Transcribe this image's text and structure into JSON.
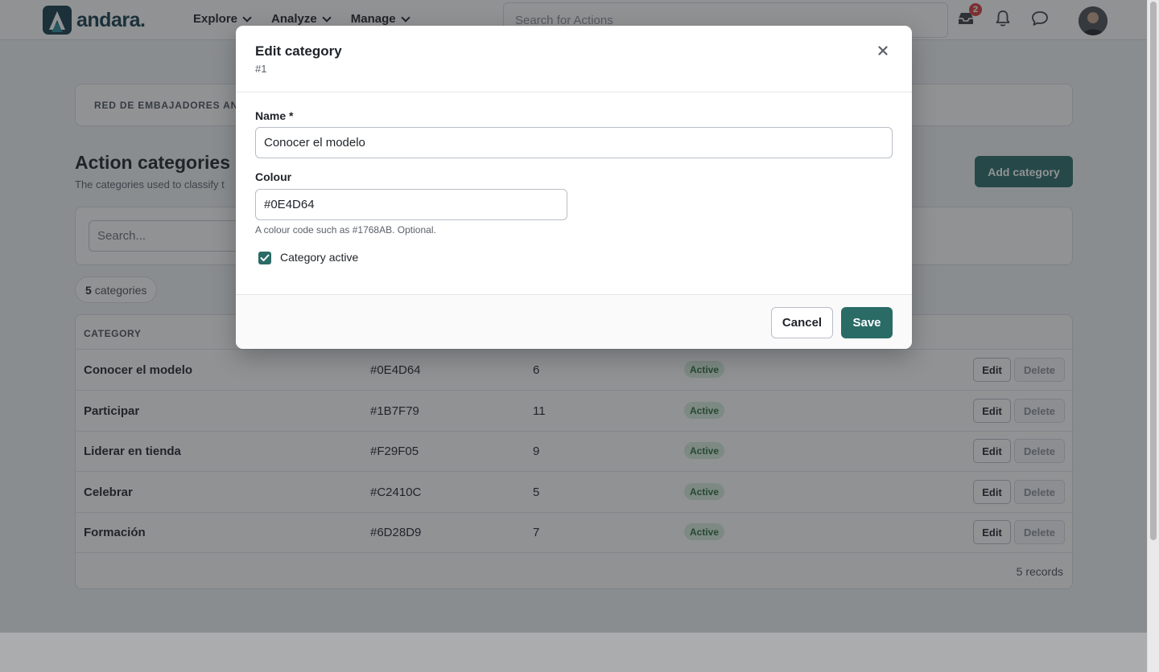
{
  "brand": {
    "name": "andara."
  },
  "nav": [
    {
      "label": "Explore"
    },
    {
      "label": "Analyze"
    },
    {
      "label": "Manage"
    }
  ],
  "top_search": {
    "placeholder": "Search for Actions"
  },
  "top_icons": {
    "inbox_badge": "2"
  },
  "breadcrumb": {
    "text": "RED DE EMBAJADORES AND"
  },
  "page": {
    "title": "Action categories",
    "subtitle": "The categories used to classify t",
    "add_label": "Add category"
  },
  "filter": {
    "search_placeholder": "Search..."
  },
  "count": {
    "number": "5",
    "label": "categories"
  },
  "table": {
    "header_category": "CATEGORY",
    "rows": [
      {
        "name": "Conocer el modelo",
        "colour": "#0E4D64",
        "count": "6",
        "status": "Active"
      },
      {
        "name": "Participar",
        "colour": "#1B7F79",
        "count": "11",
        "status": "Active"
      },
      {
        "name": "Liderar en tienda",
        "colour": "#F29F05",
        "count": "9",
        "status": "Active"
      },
      {
        "name": "Celebrar",
        "colour": "#C2410C",
        "count": "5",
        "status": "Active"
      },
      {
        "name": "Formación",
        "colour": "#6D28D9",
        "count": "7",
        "status": "Active"
      }
    ],
    "edit_label": "Edit",
    "delete_label": "Delete",
    "records": "5 records"
  },
  "modal": {
    "title": "Edit category",
    "subtitle": "#1",
    "name_label": "Name *",
    "name_value": "Conocer el modelo",
    "colour_label": "Colour",
    "colour_value": "#0E4D64",
    "colour_hint": "A colour code such as #1768AB. Optional.",
    "active_label": "Category active",
    "active_checked": true,
    "cancel_label": "Cancel",
    "save_label": "Save"
  },
  "colors": {
    "accent": "#2a6b66",
    "brand": "#143a48",
    "badge": "#d73a3a",
    "status_bg": "#d8ecdc",
    "status_text": "#2a6b3a"
  }
}
